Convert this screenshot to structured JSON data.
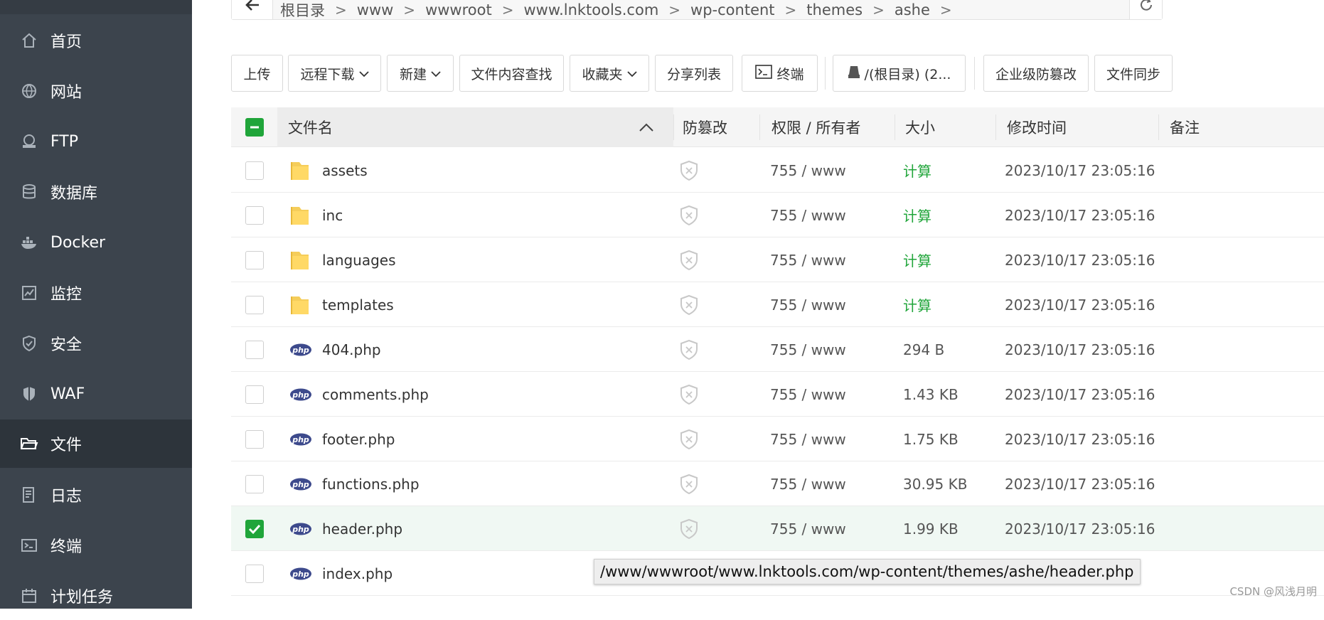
{
  "sidebar": {
    "items": [
      {
        "label": "首页",
        "icon": "home-icon"
      },
      {
        "label": "网站",
        "icon": "globe-icon"
      },
      {
        "label": "FTP",
        "icon": "ftp-icon"
      },
      {
        "label": "数据库",
        "icon": "database-icon"
      },
      {
        "label": "Docker",
        "icon": "docker-icon"
      },
      {
        "label": "监控",
        "icon": "monitor-icon"
      },
      {
        "label": "安全",
        "icon": "shield-icon"
      },
      {
        "label": "WAF",
        "icon": "waf-shield-icon"
      },
      {
        "label": "文件",
        "icon": "folder-icon",
        "active": true
      },
      {
        "label": "日志",
        "icon": "log-icon"
      },
      {
        "label": "终端",
        "icon": "terminal-icon"
      },
      {
        "label": "计划任务",
        "icon": "calendar-icon"
      }
    ]
  },
  "breadcrumb": {
    "segments": [
      "根目录",
      "www",
      "wwwroot",
      "www.lnktools.com",
      "wp-content",
      "themes",
      "ashe"
    ]
  },
  "toolbar": {
    "upload": "上传",
    "remote_download": "远程下载",
    "new": "新建",
    "search_content": "文件内容查找",
    "favorites": "收藏夹",
    "share_list": "分享列表",
    "terminal": "终端",
    "disk": "/(根目录) (2...",
    "tamper_proof": "企业级防篡改",
    "file_sync": "文件同步"
  },
  "table": {
    "headers": {
      "name": "文件名",
      "tamper": "防篡改",
      "perm": "权限 / 所有者",
      "size": "大小",
      "mtime": "修改时间",
      "note": "备注"
    },
    "rows": [
      {
        "name": "assets",
        "type": "folder",
        "perm": "755 / www",
        "size": "计算",
        "mtime": "2023/10/17 23:05:16",
        "checked": false
      },
      {
        "name": "inc",
        "type": "folder",
        "perm": "755 / www",
        "size": "计算",
        "mtime": "2023/10/17 23:05:16",
        "checked": false
      },
      {
        "name": "languages",
        "type": "folder",
        "perm": "755 / www",
        "size": "计算",
        "mtime": "2023/10/17 23:05:16",
        "checked": false
      },
      {
        "name": "templates",
        "type": "folder",
        "perm": "755 / www",
        "size": "计算",
        "mtime": "2023/10/17 23:05:16",
        "checked": false
      },
      {
        "name": "404.php",
        "type": "php",
        "perm": "755 / www",
        "size": "294 B",
        "mtime": "2023/10/17 23:05:16",
        "checked": false
      },
      {
        "name": "comments.php",
        "type": "php",
        "perm": "755 / www",
        "size": "1.43 KB",
        "mtime": "2023/10/17 23:05:16",
        "checked": false
      },
      {
        "name": "footer.php",
        "type": "php",
        "perm": "755 / www",
        "size": "1.75 KB",
        "mtime": "2023/10/17 23:05:16",
        "checked": false
      },
      {
        "name": "functions.php",
        "type": "php",
        "perm": "755 / www",
        "size": "30.95 KB",
        "mtime": "2023/10/17 23:05:16",
        "checked": false
      },
      {
        "name": "header.php",
        "type": "php",
        "perm": "755 / www",
        "size": "1.99 KB",
        "mtime": "2023/10/17 23:05:16",
        "checked": true
      },
      {
        "name": "index.php",
        "type": "php",
        "perm": "",
        "size": "",
        "mtime": "",
        "checked": false
      }
    ]
  },
  "tooltip": "/www/wwwroot/www.lnktools.com/wp-content/themes/ashe/header.php",
  "watermark": "CSDN @风浅月明",
  "colors": {
    "accent": "#20a53a",
    "sidebar": "#3c444d",
    "sidebar_active": "#2d343b"
  }
}
